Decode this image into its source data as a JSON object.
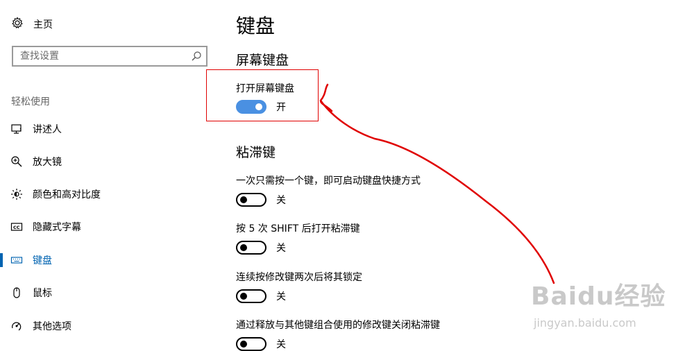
{
  "sidebar": {
    "home_label": "主页",
    "search_placeholder": "查找设置",
    "section_label": "轻松使用",
    "items": [
      {
        "label": "讲述人",
        "icon": "narrator-icon"
      },
      {
        "label": "放大镜",
        "icon": "magnifier-icon"
      },
      {
        "label": "颜色和高对比度",
        "icon": "brightness-icon"
      },
      {
        "label": "隐藏式字幕",
        "icon": "closed-caption-icon"
      },
      {
        "label": "键盘",
        "icon": "keyboard-icon",
        "active": true
      },
      {
        "label": "鼠标",
        "icon": "mouse-icon"
      },
      {
        "label": "其他选项",
        "icon": "other-options-icon"
      }
    ]
  },
  "main": {
    "page_title": "键盘",
    "on_screen_keyboard": {
      "group_title": "屏幕键盘",
      "label": "打开屏幕键盘",
      "state": "开",
      "on": true
    },
    "sticky_keys": {
      "group_title": "粘滞键",
      "options": [
        {
          "label": "一次只需按一个键，即可启动键盘快捷方式",
          "state": "关",
          "on": false
        },
        {
          "label": "按 5 次 SHIFT 后打开粘滞键",
          "state": "关",
          "on": false
        },
        {
          "label": "连续按修改键两次后将其锁定",
          "state": "关",
          "on": false
        },
        {
          "label": "通过释放与其他键组合使用的修改键关闭粘滞键",
          "state": "关",
          "on": false
        }
      ]
    }
  },
  "colors": {
    "accent": "#0063b1",
    "toggle_on": "#4a90e2",
    "annotation": "#e00000"
  },
  "watermark": {
    "logo": "Baidu经验",
    "url": "jingyan.baidu.com"
  }
}
